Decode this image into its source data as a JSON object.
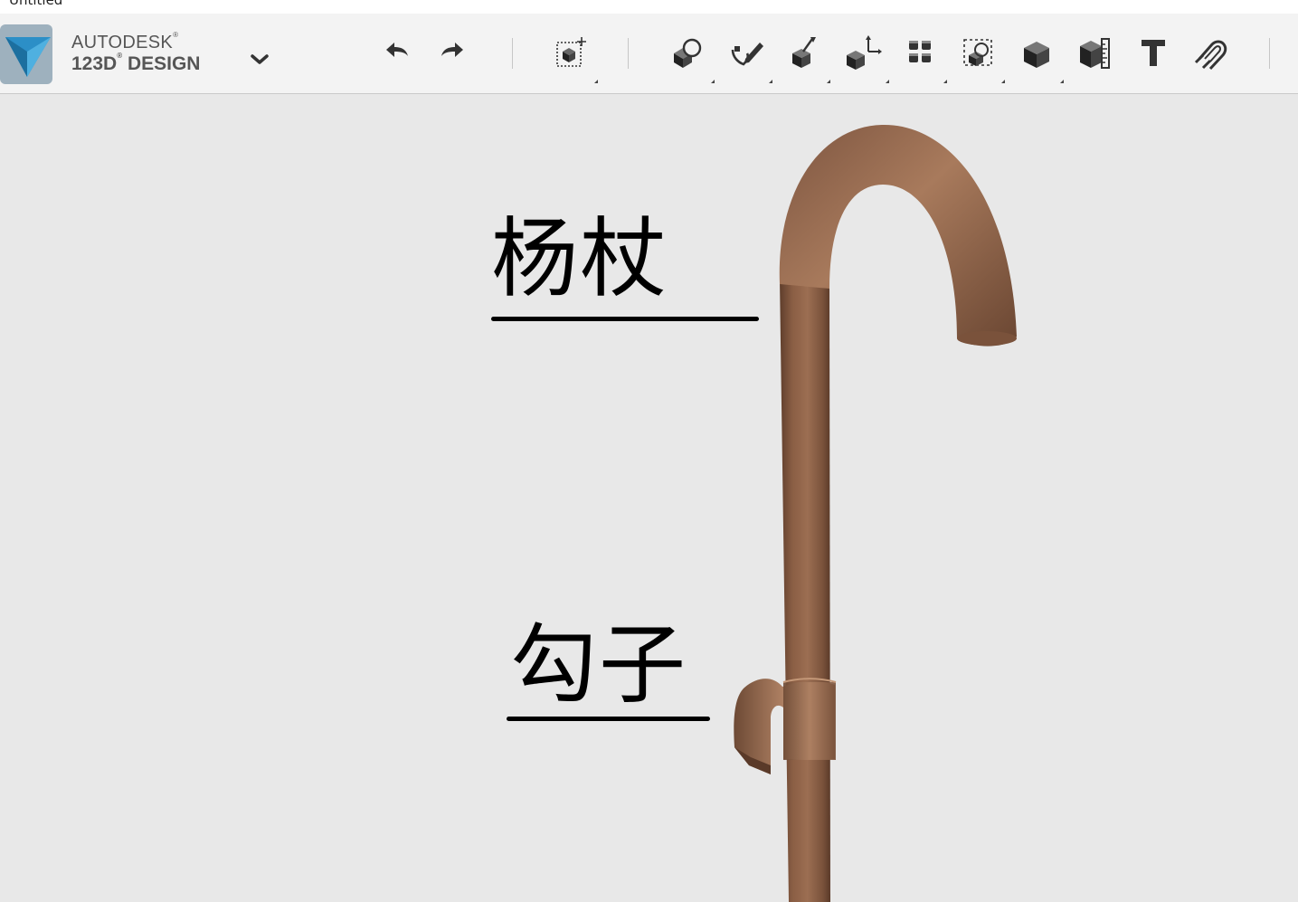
{
  "window": {
    "title": "Untitled"
  },
  "brand": {
    "line1": "AUTODESK",
    "line2_a": "123D",
    "line2_b": " DESIGN",
    "reg_mark": "®"
  },
  "toolbar": {
    "buttons": [
      {
        "name": "undo-button",
        "icon": "undo-arrow-icon"
      },
      {
        "name": "redo-button",
        "icon": "redo-arrow-icon"
      },
      {
        "name": "transform-button",
        "icon": "transform-box-icon"
      },
      {
        "name": "primitives-button",
        "icon": "primitives-icon"
      },
      {
        "name": "sketch-button",
        "icon": "sketch-pen-icon"
      },
      {
        "name": "construct-button",
        "icon": "construct-icon"
      },
      {
        "name": "modify-button",
        "icon": "modify-arrows-icon"
      },
      {
        "name": "pattern-button",
        "icon": "pattern-grid-icon"
      },
      {
        "name": "group-button",
        "icon": "group-icon"
      },
      {
        "name": "combine-button",
        "icon": "combine-cube-icon"
      },
      {
        "name": "measure-button",
        "icon": "measure-ruler-icon"
      },
      {
        "name": "text-button",
        "icon": "text-T-icon"
      },
      {
        "name": "snap-button",
        "icon": "snap-magnet-icon"
      }
    ]
  },
  "annotations": {
    "cane_label": "杨杖",
    "hook_label": "勾子"
  },
  "colors": {
    "wood": "#8a5e44",
    "wood_light": "#a87a5c",
    "wood_dark": "#5f3e2c",
    "toolbar_bg": "#f3f3f3",
    "viewport_bg": "#e8e8e8",
    "logo_blue": "#2c8fc7"
  }
}
